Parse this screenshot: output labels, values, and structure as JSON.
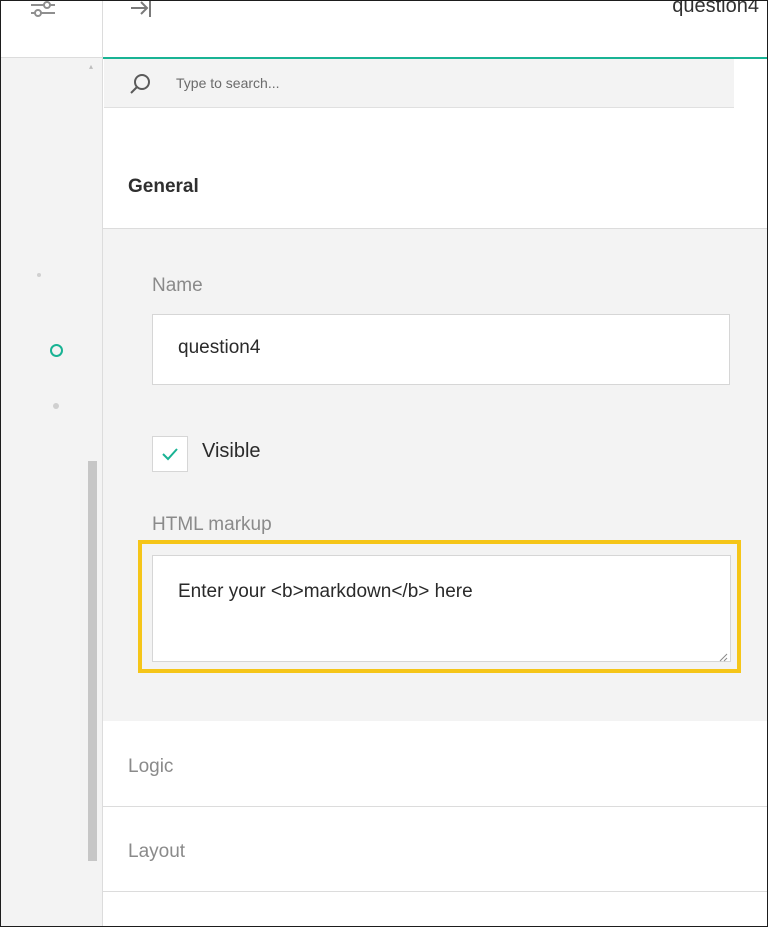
{
  "header": {
    "title": "question4"
  },
  "search": {
    "placeholder": "Type to search..."
  },
  "sections": {
    "general": {
      "title": "General",
      "name_label": "Name",
      "name_value": "question4",
      "visible_label": "Visible",
      "visible_checked": true,
      "html_markup_label": "HTML markup",
      "html_markup_value": "Enter your <b>markdown</b> here"
    },
    "logic": {
      "title": "Logic"
    },
    "layout": {
      "title": "Layout"
    }
  },
  "icons": {
    "settings": "sliders-icon",
    "collapse": "collapse-panel-icon",
    "search": "search-icon",
    "check": "checkmark-icon"
  },
  "colors": {
    "accent": "#19b394",
    "highlight": "#f5c518",
    "panel_bg": "#f3f3f3",
    "label_gray": "#8a8a8a"
  }
}
